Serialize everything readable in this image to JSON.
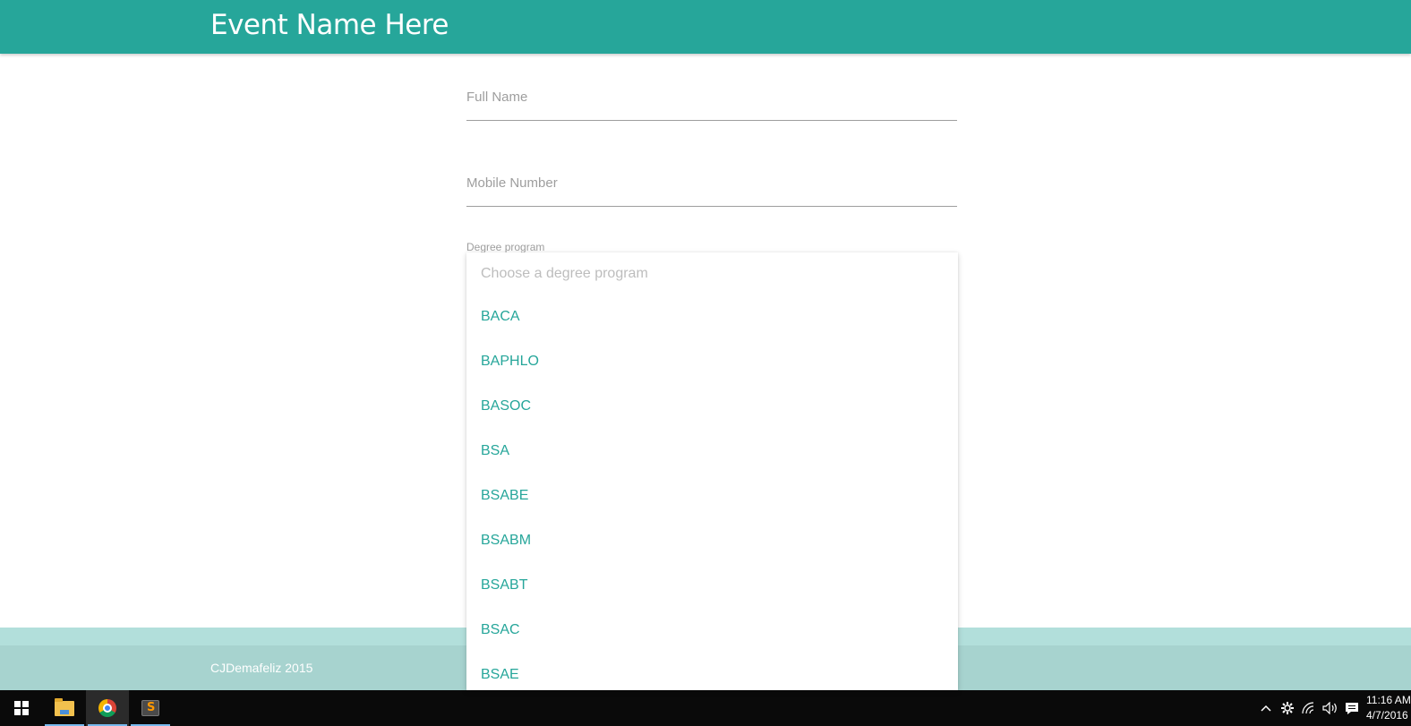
{
  "header": {
    "title": "Event Name Here"
  },
  "form": {
    "full_name": {
      "placeholder": "Full Name"
    },
    "mobile": {
      "placeholder": "Mobile Number"
    },
    "degree": {
      "label": "Degree program",
      "placeholder": "Choose a degree program",
      "options": [
        "BACA",
        "BAPHLO",
        "BASOC",
        "BSA",
        "BSABE",
        "BSABM",
        "BSABT",
        "BSAC",
        "BSAE"
      ]
    }
  },
  "footer": {
    "copyright": "CJDemafeliz 2015"
  },
  "colors": {
    "primary": "#26a69a",
    "footer": "#a7d3cf",
    "taskbar": "#0a0a0a"
  },
  "taskbar": {
    "apps": [
      {
        "icon": "windows-start-icon"
      },
      {
        "icon": "file-explorer-icon"
      },
      {
        "icon": "chrome-icon"
      },
      {
        "icon": "sublime-text-icon"
      }
    ],
    "tray_icons": [
      "chevron-up-icon",
      "settings-icon",
      "wifi-icon",
      "volume-icon",
      "notification-icon"
    ],
    "time": "11:16 AM",
    "date": "4/7/2016"
  }
}
